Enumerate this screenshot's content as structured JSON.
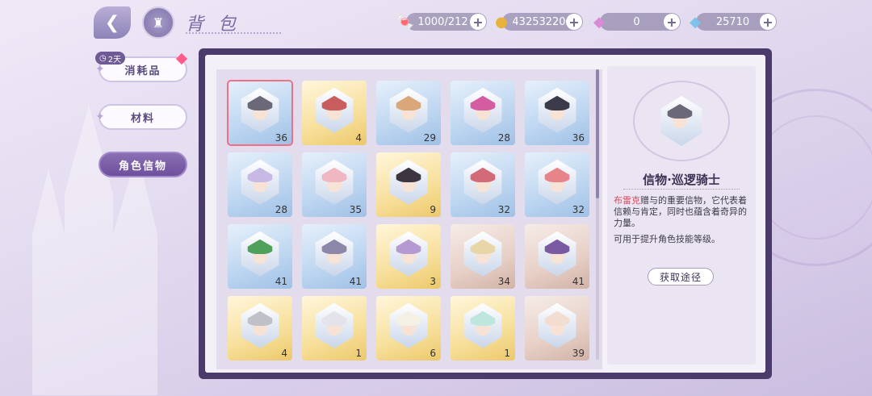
{
  "header": {
    "back_icon": "back-arrow-icon",
    "home_icon": "castle-icon",
    "title": "背包"
  },
  "currencies": [
    {
      "icon": "candy-icon",
      "value": "1000/212",
      "color": "#e7708a"
    },
    {
      "icon": "gold-coin-icon",
      "value": "43253220",
      "color": "#e8b23a"
    },
    {
      "icon": "pink-diamond-icon",
      "value": "0",
      "color": "#d98bd8"
    },
    {
      "icon": "blue-diamond-icon",
      "value": "25710",
      "color": "#7ec2ea"
    }
  ],
  "tabs": [
    {
      "label": "消耗品",
      "badge": "2天",
      "active": false
    },
    {
      "label": "材料",
      "active": false
    },
    {
      "label": "角色信物",
      "active": true
    }
  ],
  "items": [
    {
      "rarity": "blue",
      "count": "36",
      "hair": "#6b6878",
      "selected": true
    },
    {
      "rarity": "gold",
      "count": "4",
      "hair": "#c95c5c"
    },
    {
      "rarity": "blue",
      "count": "29",
      "hair": "#d9a77a"
    },
    {
      "rarity": "blue",
      "count": "28",
      "hair": "#d45ca0"
    },
    {
      "rarity": "blue",
      "count": "36",
      "hair": "#3a3a48"
    },
    {
      "rarity": "blue",
      "count": "28",
      "hair": "#c8b8e6"
    },
    {
      "rarity": "blue",
      "count": "35",
      "hair": "#f0b6c2"
    },
    {
      "rarity": "gold",
      "count": "9",
      "hair": "#3b3640"
    },
    {
      "rarity": "blue",
      "count": "32",
      "hair": "#d26a78"
    },
    {
      "rarity": "blue",
      "count": "32",
      "hair": "#e6848a"
    },
    {
      "rarity": "blue",
      "count": "41",
      "hair": "#4fa05a"
    },
    {
      "rarity": "blue",
      "count": "41",
      "hair": "#8c86a8"
    },
    {
      "rarity": "gold",
      "count": "3",
      "hair": "#b49ad0"
    },
    {
      "rarity": "bronze",
      "count": "34",
      "hair": "#e8d6a8"
    },
    {
      "rarity": "bronze",
      "count": "41",
      "hair": "#7a5aa0"
    },
    {
      "rarity": "gold",
      "count": "4",
      "hair": "#c0c0c8"
    },
    {
      "rarity": "gold",
      "count": "1",
      "hair": "#e4e2ea"
    },
    {
      "rarity": "gold",
      "count": "6",
      "hair": "#f4f0e4"
    },
    {
      "rarity": "gold",
      "count": "1",
      "hair": "#bfe6dc"
    },
    {
      "rarity": "bronze",
      "count": "39",
      "hair": "#f3ddd0"
    }
  ],
  "detail": {
    "name": "信物·巡逻骑士",
    "giver": "布雷克",
    "description": "赠与的重要信物，它代表着信赖与肯定，同时也蕴含着奇异的力量。",
    "usage": "可用于提升角色技能等级。",
    "obtain_label": "获取途径",
    "hair": "#6b6878"
  }
}
